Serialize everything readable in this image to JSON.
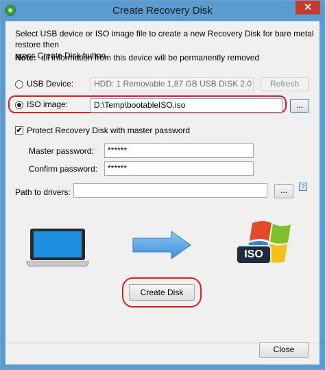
{
  "window": {
    "title": "Create Recovery Disk",
    "close_glyph": "✕"
  },
  "intro": {
    "line1": "Select USB device or ISO image file to create a new Recovery Disk for bare metal restore then",
    "line2": "press Create Disk button.",
    "note_label": "Note:",
    "note_text": "all information from this device will be permanently removed"
  },
  "usb": {
    "label": "USB Device:",
    "selected": false,
    "device": "HDD: 1 Removable 1,87 GB USB DISK 2.0 USB",
    "refresh_label": "Refresh"
  },
  "iso": {
    "label": "ISO image:",
    "selected": true,
    "path": "D:\\Temp\\bootableISO.iso",
    "browse_label": "..."
  },
  "protect": {
    "label": "Protect Recovery Disk with master password",
    "checked": true,
    "master_label": "Master password:",
    "master_value": "******",
    "confirm_label": "Confirm password:",
    "confirm_value": "******"
  },
  "drivers": {
    "label": "Path to drivers:",
    "value": "",
    "browse_label": "...",
    "help_glyph": "?"
  },
  "illustration": {
    "source_icon": "laptop-icon",
    "arrow_icon": "arrow-right-icon",
    "target_icon": "windows-iso-icon",
    "iso_badge": "ISO"
  },
  "actions": {
    "create_label": "Create Disk",
    "close_label": "Close"
  },
  "colors": {
    "titlebar": "#5a9bd0",
    "highlight": "#d42020",
    "arrow": "#5aa6e8"
  }
}
